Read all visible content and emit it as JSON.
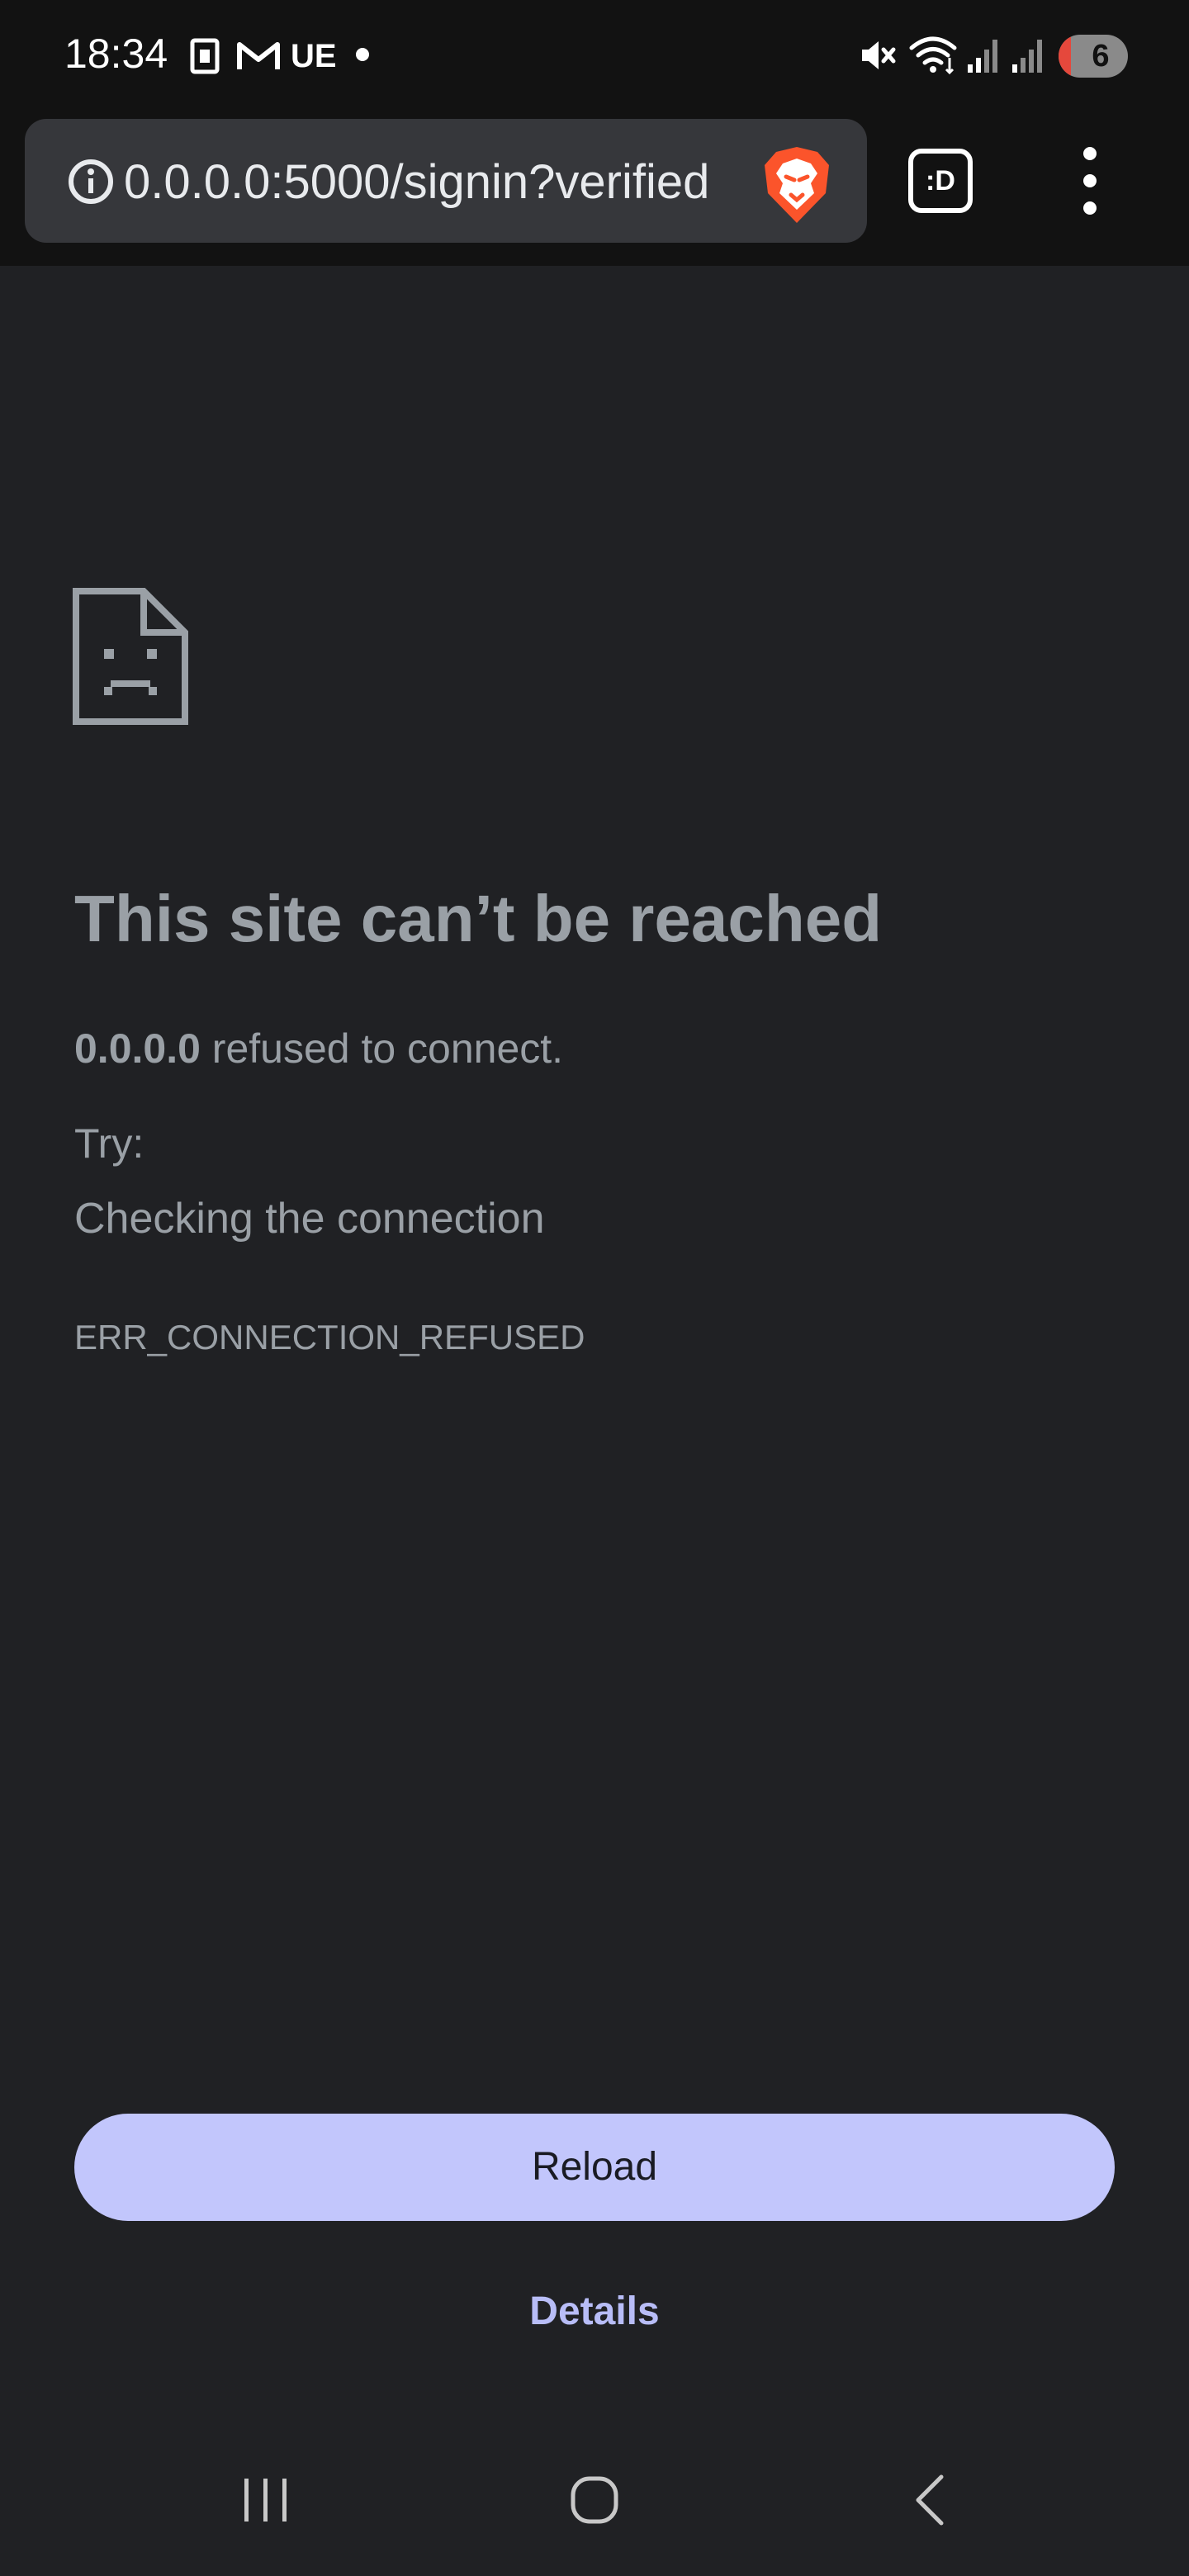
{
  "status_bar": {
    "time": "18:34",
    "carrier": "UE",
    "battery_level": "6",
    "battery_fraction": 0.06,
    "icons": [
      "sim-card-icon",
      "gmail-icon",
      "notification-dot-icon",
      "mute-icon",
      "wifi-icon",
      "signal-icon",
      "signal-icon-2",
      "battery-icon"
    ]
  },
  "toolbar": {
    "url": "0.0.0.0:5000/signin?verified",
    "tabs_label": ":D",
    "icons": [
      "info-icon",
      "brave-shield-icon",
      "tabs-icon",
      "more-menu-icon"
    ]
  },
  "error": {
    "title": "This site can’t be reached",
    "host": "0.0.0.0",
    "message": " refused to connect.",
    "try_label": "Try:",
    "suggestion": "Checking the connection",
    "code": "ERR_CONNECTION_REFUSED"
  },
  "buttons": {
    "reload": "Reload",
    "details": "Details"
  },
  "nav_bar": {
    "icons": [
      "recent-apps-icon",
      "home-icon",
      "back-icon"
    ]
  },
  "colors": {
    "background": "#202124",
    "chrome": "#121212",
    "omnibox": "#36373b",
    "text_muted": "#9aa0a6",
    "reload_button": "#c2c6fc",
    "details_link": "#b8bdf7",
    "battery_low": "#e5483c"
  }
}
